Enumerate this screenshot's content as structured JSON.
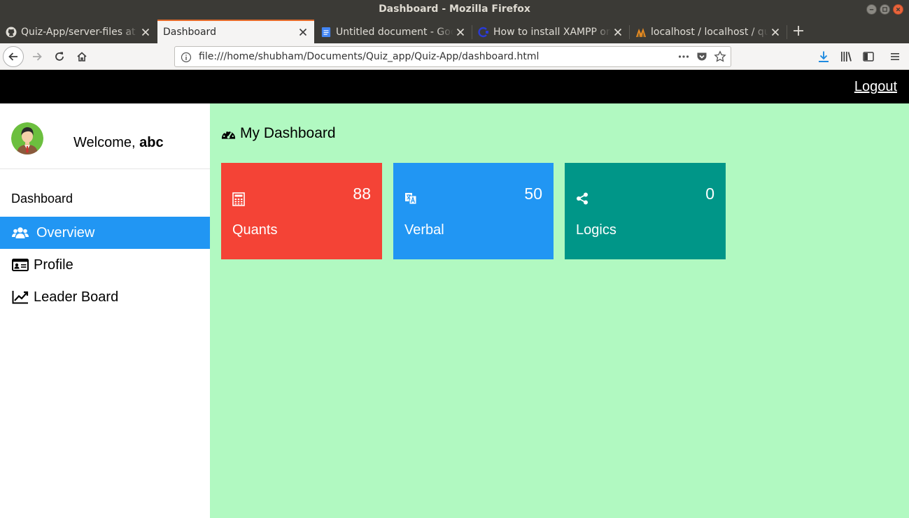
{
  "window": {
    "title": "Dashboard - Mozilla Firefox"
  },
  "tabs": [
    {
      "label": "Quiz-App/server-files at",
      "icon": "github-icon",
      "active": false
    },
    {
      "label": "Dashboard",
      "icon": "",
      "active": true
    },
    {
      "label": "Untitled document - Goo",
      "icon": "google-docs-icon",
      "active": false
    },
    {
      "label": "How to install XAMPP on",
      "icon": "site-c-icon",
      "active": false
    },
    {
      "label": "localhost / localhost / qu",
      "icon": "phpmyadmin-icon",
      "active": false
    }
  ],
  "urlbar": {
    "url": "file:///home/shubham/Documents/Quiz_app/Quiz-App/dashboard.html"
  },
  "topbar": {
    "logout_label": "Logout"
  },
  "sidebar": {
    "welcome_prefix": "Welcome, ",
    "username": "abc",
    "heading": "Dashboard",
    "items": [
      {
        "label": "Overview",
        "icon": "users-icon",
        "active": true
      },
      {
        "label": "Profile",
        "icon": "id-card-icon",
        "active": false
      },
      {
        "label": "Leader Board",
        "icon": "line-chart-icon",
        "active": false
      }
    ]
  },
  "main": {
    "title": "My Dashboard",
    "title_icon": "dashboard-gauge-icon",
    "cards": [
      {
        "label": "Quants",
        "value": "88",
        "icon": "calculator-icon",
        "color": "#f44336"
      },
      {
        "label": "Verbal",
        "value": "50",
        "icon": "translate-icon",
        "color": "#2196f3"
      },
      {
        "label": "Logics",
        "value": "0",
        "icon": "share-icon",
        "color": "#009688"
      }
    ]
  },
  "colors": {
    "page_bg": "#b1f9c1",
    "accent": "#2196f3",
    "topbar": "#000000"
  }
}
